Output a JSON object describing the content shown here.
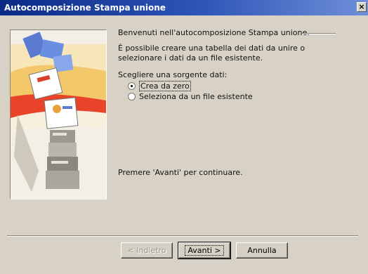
{
  "window": {
    "title": "Autocomposizione Stampa unione",
    "close_glyph": "×"
  },
  "wizard": {
    "welcome": "Benvenuti nell'autocomposizione Stampa unione.",
    "description": "È possibile creare una tabella dei dati da unire o selezionare i dati da un file esistente.",
    "choose_source": "Scegliere una sorgente dati:",
    "options": [
      {
        "label": "Crea da zero",
        "selected": true
      },
      {
        "label": "Seleziona da un file esistente",
        "selected": false
      }
    ],
    "continue_hint": "Premere 'Avanti' per continuare."
  },
  "buttons": {
    "back": "< Indietro",
    "next": "Avanti >",
    "cancel": "Annulla"
  }
}
